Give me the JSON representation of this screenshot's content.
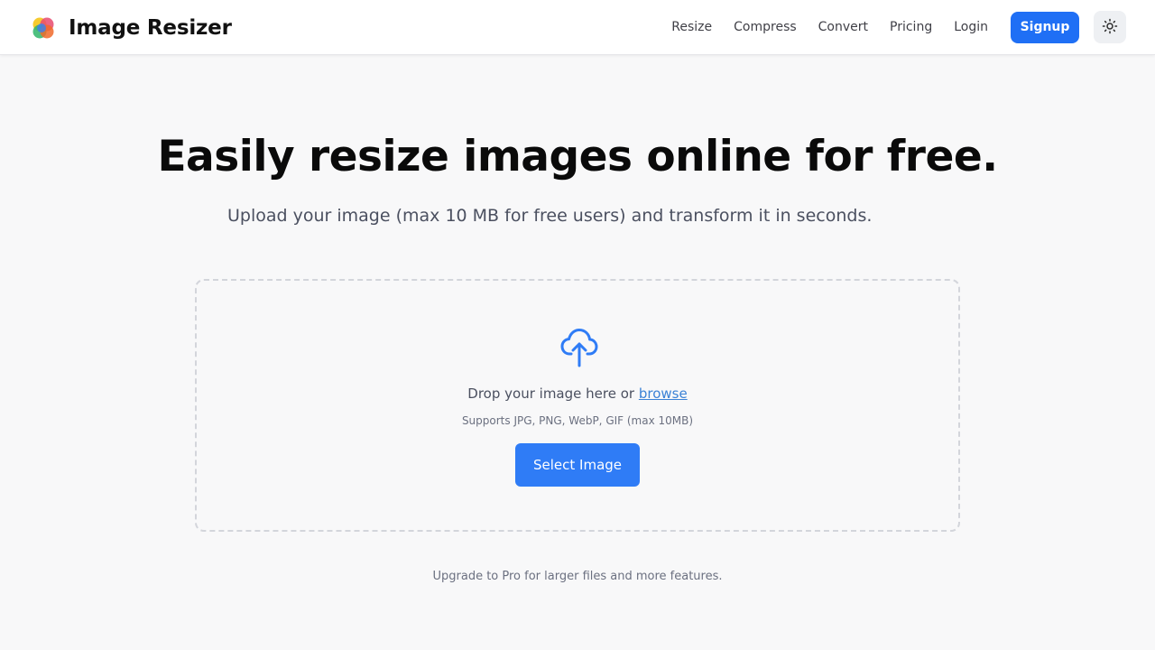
{
  "header": {
    "brand_name": "Image Resizer",
    "logo_icon": "multicolor-circles-logo",
    "nav": [
      "Resize",
      "Compress",
      "Convert",
      "Pricing",
      "Login"
    ],
    "signup_label": "Signup",
    "theme_toggle_icon": "sun-icon"
  },
  "hero": {
    "title": "Easily resize images online for free.",
    "subtitle": "Upload your image (max 10 MB for free users) and transform it in seconds."
  },
  "dropzone": {
    "icon": "cloud-upload-icon",
    "drop_text": "Drop your image here or",
    "browse_label": "browse",
    "supports_text": "Supports JPG, PNG, WebP, GIF (max 10MB)",
    "select_button_label": "Select Image"
  },
  "footer": {
    "upgrade_text": "Upgrade to Pro for larger files and more features."
  },
  "colors": {
    "accent": "#1f6ff5",
    "select_button": "#2f7cf6",
    "link": "#3b82d6",
    "background": "#f8f8f9"
  }
}
